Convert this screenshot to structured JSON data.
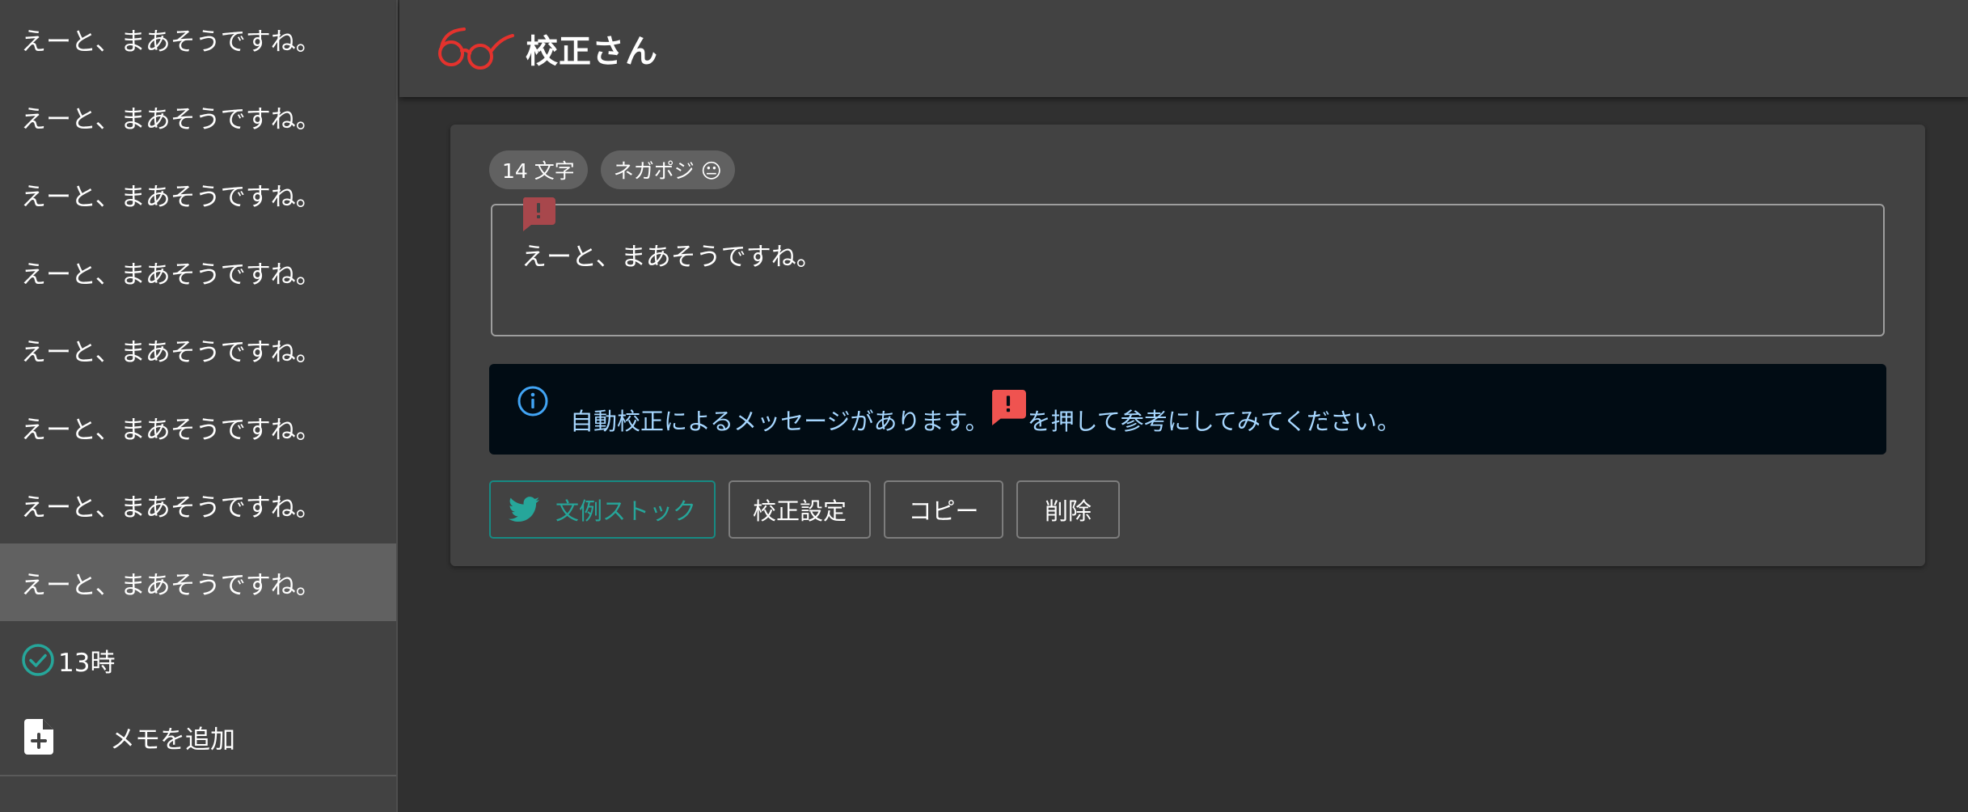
{
  "sidebar": {
    "memos": [
      {
        "text": "えーと、まあそうですね。"
      },
      {
        "text": "えーと、まあそうですね。"
      },
      {
        "text": "えーと、まあそうですね。"
      },
      {
        "text": "えーと、まあそうですね。"
      },
      {
        "text": "えーと、まあそうですね。"
      },
      {
        "text": "えーと、まあそうですね。"
      },
      {
        "text": "えーと、まあそうですね。"
      },
      {
        "text": "えーと、まあそうですね。"
      }
    ],
    "selected_index": 7,
    "time_label": "13時",
    "add_memo_label": "メモを追加"
  },
  "header": {
    "title": "校正さん",
    "logo_icon": "glasses-icon"
  },
  "editor": {
    "char_count_chip": "14 文字",
    "sentiment_chip": "ネガポジ 😐",
    "memo_text": "えーと、まあそうですね。",
    "alert": {
      "text_before": "自動校正によるメッセージがあります。",
      "text_after": "を押して参考にしてみてください。"
    },
    "buttons": {
      "stock_label": "文例ストック",
      "settings_label": "校正設定",
      "copy_label": "コピー",
      "delete_label": "削除"
    }
  },
  "colors": {
    "accent_teal": "#26a69a",
    "logo_red": "#e5322d",
    "flag_red": "#ef5350",
    "info_blue": "#42a5f5"
  }
}
